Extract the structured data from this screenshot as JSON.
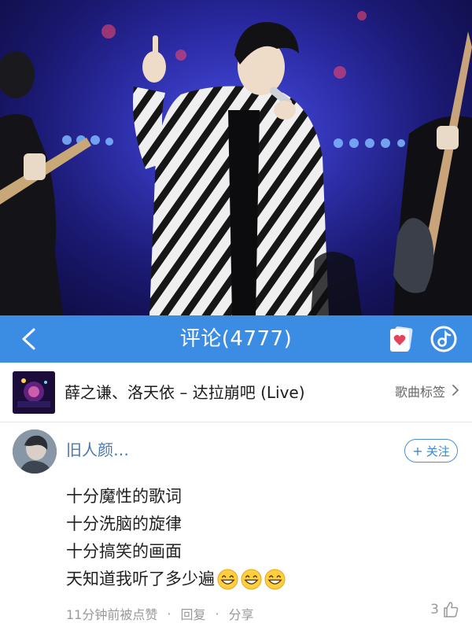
{
  "header": {
    "title": "评论(4777)",
    "back_icon": "chevron-left-icon",
    "card_icon": "heart-card-icon",
    "music_icon": "music-disc-icon",
    "bar_color": "#3a8de3"
  },
  "song": {
    "title": "薛之谦、洛天依 – 达拉崩吧 (Live)",
    "tag_label": "歌曲标签",
    "tag_icon": "chevron-right-icon"
  },
  "comment": {
    "username": "旧人颜…",
    "follow_label": "关注",
    "lines": [
      "十分魔性的歌词",
      "十分洗脑的旋律",
      "十分搞笑的画面",
      "天知道我听了多少遍"
    ],
    "emoji": [
      "grin-emoji",
      "grin-emoji",
      "grin-emoji"
    ],
    "time_text": "11分钟前被点赞",
    "reply_label": "回复",
    "share_label": "分享",
    "separator": "·",
    "like_count": "3",
    "like_icon": "thumbs-up-icon"
  }
}
